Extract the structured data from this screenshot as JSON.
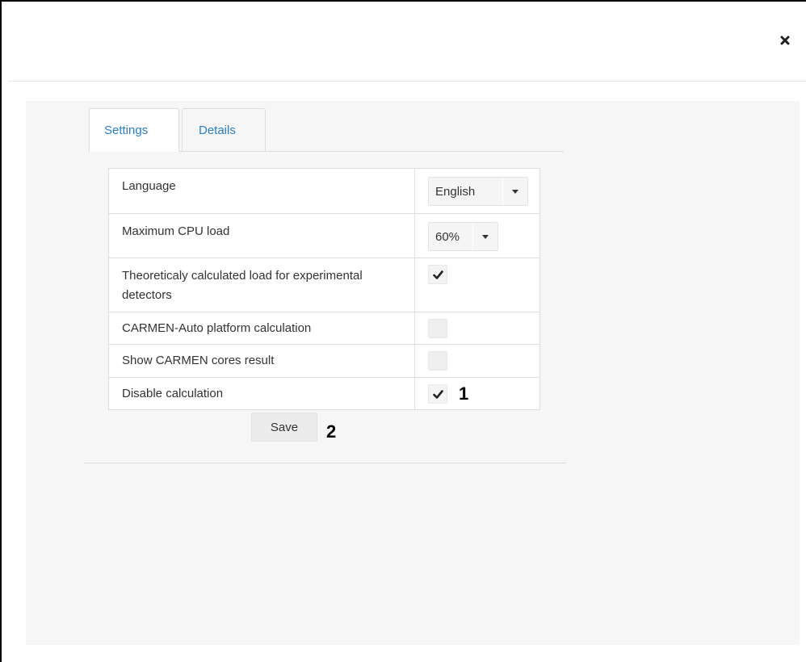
{
  "dialog": {
    "close_icon": "close-icon"
  },
  "tabs": [
    {
      "label": "Settings",
      "active": true
    },
    {
      "label": "Details",
      "active": false
    }
  ],
  "settings": {
    "language": {
      "label": "Language",
      "value": "English"
    },
    "cpu_load": {
      "label": "Maximum CPU load",
      "value": "60%"
    },
    "theoretical_load": {
      "label": "Theoreticaly calculated load for experimental detectors",
      "checked": true
    },
    "carmen_auto": {
      "label": "CARMEN-Auto platform calculation",
      "checked": false
    },
    "show_cores": {
      "label": "Show CARMEN cores result",
      "checked": false
    },
    "disable_calc": {
      "label": "Disable calculation",
      "checked": true
    }
  },
  "save_label": "Save",
  "annotations": {
    "marker_1": "1",
    "marker_2": "2"
  },
  "colors": {
    "tab_link": "#2a7fc3",
    "panel_bg": "#f6f6f6",
    "border": "#dddddd"
  }
}
